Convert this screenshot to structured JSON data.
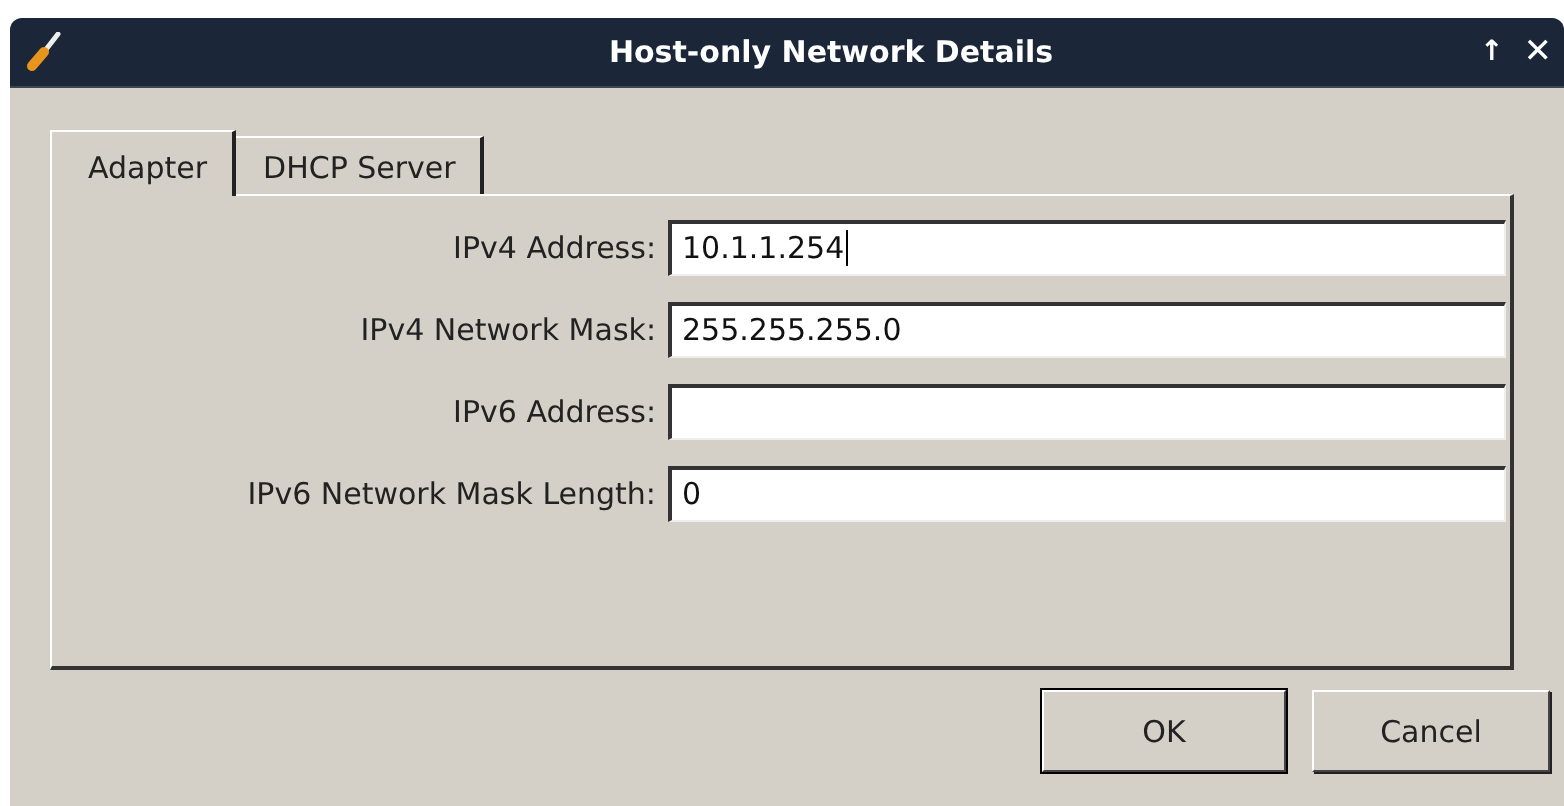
{
  "window": {
    "title": "Host-only Network Details",
    "controls": [
      {
        "kind": "shade",
        "glyph": "↑"
      },
      {
        "kind": "close",
        "glyph": "✕"
      }
    ]
  },
  "tabs": [
    {
      "label": "Adapter",
      "selected": true
    },
    {
      "label": "DHCP Server",
      "selected": false
    }
  ],
  "fields": [
    {
      "label": "IPv4 Address:",
      "value": "10.1.1.254",
      "focused": true
    },
    {
      "label": "IPv4 Network Mask:",
      "value": "255.255.255.0",
      "focused": false
    },
    {
      "label": "IPv6 Address:",
      "focused": false
    },
    {
      "label": "IPv6 Network Mask Length:",
      "value": "0",
      "focused": false
    }
  ],
  "buttons": [
    {
      "label": "OK",
      "default": true
    },
    {
      "label": "Cancel",
      "default": false
    }
  ]
}
